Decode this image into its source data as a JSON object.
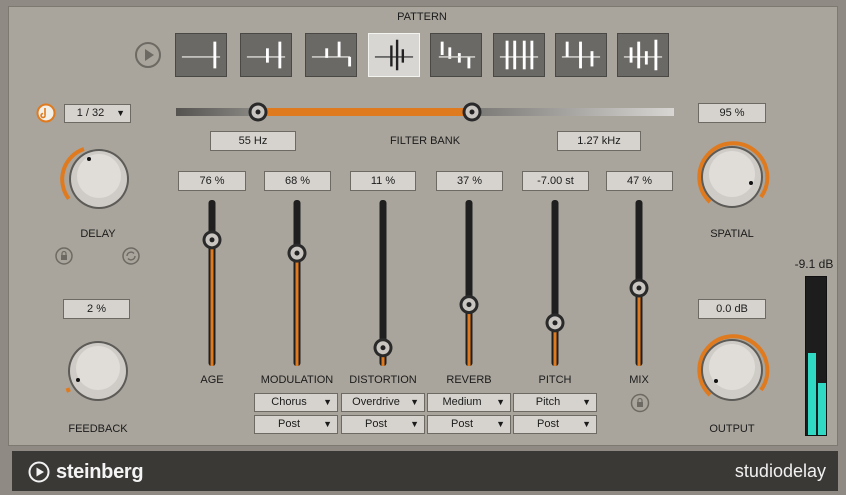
{
  "pattern": {
    "title": "PATTERN",
    "selected_index": 3,
    "count": 8
  },
  "filter": {
    "title": "FILTER BANK",
    "low_value": "55 Hz",
    "high_value": "1.27 kHz"
  },
  "delay": {
    "sync_value": "1 / 32",
    "label": "DELAY",
    "feedback_value": "2 %",
    "feedback_label": "FEEDBACK"
  },
  "sliders": [
    {
      "value": "76 %",
      "label": "AGE",
      "level": 0.76
    },
    {
      "value": "68 %",
      "label": "MODULATION",
      "level": 0.68
    },
    {
      "value": "11 %",
      "label": "DISTORTION",
      "level": 0.11
    },
    {
      "value": "37 %",
      "label": "REVERB",
      "level": 0.37
    },
    {
      "value": "-7.00 st",
      "label": "PITCH",
      "level": 0.26
    },
    {
      "value": "47 %",
      "label": "MIX",
      "level": 0.47
    }
  ],
  "dropdowns": [
    {
      "type": "Chorus",
      "mode": "Post"
    },
    {
      "type": "Overdrive",
      "mode": "Post"
    },
    {
      "type": "Medium",
      "mode": "Post"
    },
    {
      "type": "Pitch",
      "mode": "Post"
    }
  ],
  "spatial": {
    "value": "95 %",
    "label": "SPATIAL"
  },
  "output": {
    "value": "0.0 dB",
    "label": "OUTPUT"
  },
  "meter": {
    "value": "-9.1 dB",
    "left_level": 0.52,
    "right_level": 0.33
  },
  "footer": {
    "brand": "steinberg",
    "product": "studiodelay"
  },
  "colors": {
    "accent": "#e07a1f",
    "meter": "#2fd9c4",
    "panel": "#a9a59c",
    "footer": "#3a3936"
  }
}
